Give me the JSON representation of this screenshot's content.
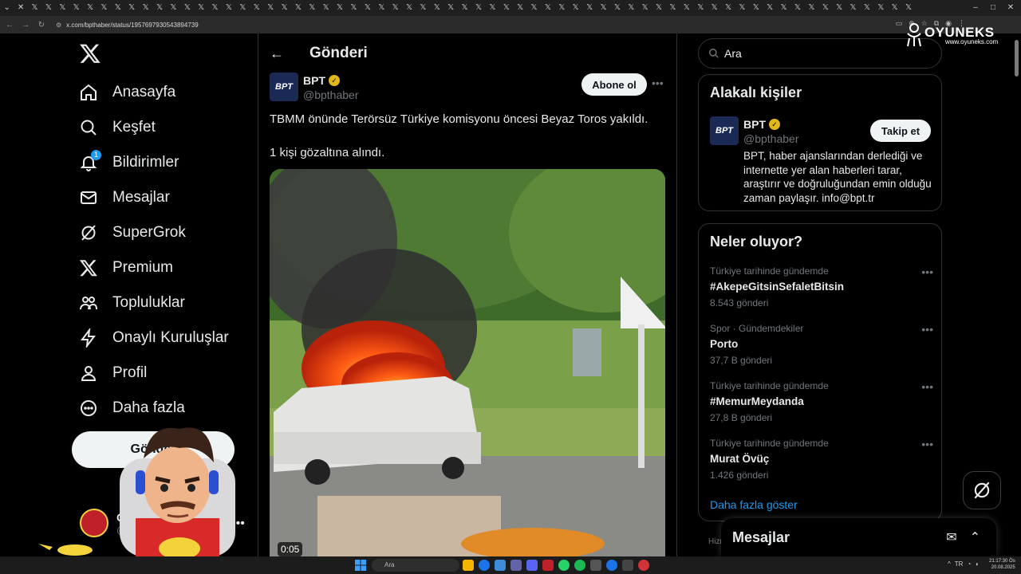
{
  "browser": {
    "url": "x.com/bpthaber/status/1957697930543894739"
  },
  "left_nav": {
    "items": [
      {
        "label": "Anasayfa",
        "icon": "home-icon"
      },
      {
        "label": "Keşfet",
        "icon": "search-icon"
      },
      {
        "label": "Bildirimler",
        "icon": "bell-icon",
        "badge": "1"
      },
      {
        "label": "Mesajlar",
        "icon": "mail-icon"
      },
      {
        "label": "SuperGrok",
        "icon": "grok-icon"
      },
      {
        "label": "Premium",
        "icon": "x-logo-icon"
      },
      {
        "label": "Topluluklar",
        "icon": "people-icon"
      },
      {
        "label": "Onaylı Kuruluşlar",
        "icon": "lightning-icon"
      },
      {
        "label": "Profil",
        "icon": "person-icon"
      },
      {
        "label": "Daha fazla",
        "icon": "more-circle-icon"
      }
    ],
    "post_button": "Gönder",
    "profile": {
      "name": "C",
      "handle": "@c"
    }
  },
  "center": {
    "title": "Gönderi",
    "tweet": {
      "author_name": "BPT",
      "author_handle": "@bpthaber",
      "avatar_text": "BPT",
      "subscribe_label": "Abone ol",
      "text_line1": "TBMM önünde Terörsüz Türkiye komisyonu öncesi Beyaz Toros yakıldı.",
      "text_line2": "1 kişi gözaltına alındı.",
      "video_time": "0:05"
    }
  },
  "right": {
    "search_placeholder": "Ara",
    "brand": {
      "name": "OYUNEKS",
      "url": "www.oyuneks.com"
    },
    "related": {
      "title": "Alakalı kişiler",
      "name": "BPT",
      "handle": "@bpthaber",
      "follow_label": "Takip et",
      "bio": "BPT, haber ajanslarından derlediği ve internette yer alan haberleri tarar, araştırır ve doğruluğundan emin olduğu zaman paylaşır. info@bpt.tr"
    },
    "trends": {
      "title": "Neler oluyor?",
      "items": [
        {
          "meta": "Türkiye tarihinde gündemde",
          "name": "#AkepeGitsinSefaletBitsin",
          "count": "8.543 gönderi"
        },
        {
          "meta": "Spor · Gündemdekiler",
          "name": "Porto",
          "count": "37,7 B gönderi"
        },
        {
          "meta": "Türkiye tarihinde gündemde",
          "name": "#MemurMeydanda",
          "count": "27,8 B gönderi"
        },
        {
          "meta": "Türkiye tarihinde gündemde",
          "name": "Murat Övüç",
          "count": "1.426 gönderi"
        }
      ],
      "show_more": "Daha fazla göster"
    },
    "messages_drawer": "Mesajlar",
    "footer_hint": "Hizm"
  },
  "taskbar": {
    "search": "Ara",
    "time": "21:17:30 Ös",
    "date": "20.08.2025"
  },
  "colors": {
    "accent": "#1d9bf0",
    "verified": "#e2b719",
    "background": "#000000",
    "border": "#2f3336",
    "muted": "#71767b"
  }
}
